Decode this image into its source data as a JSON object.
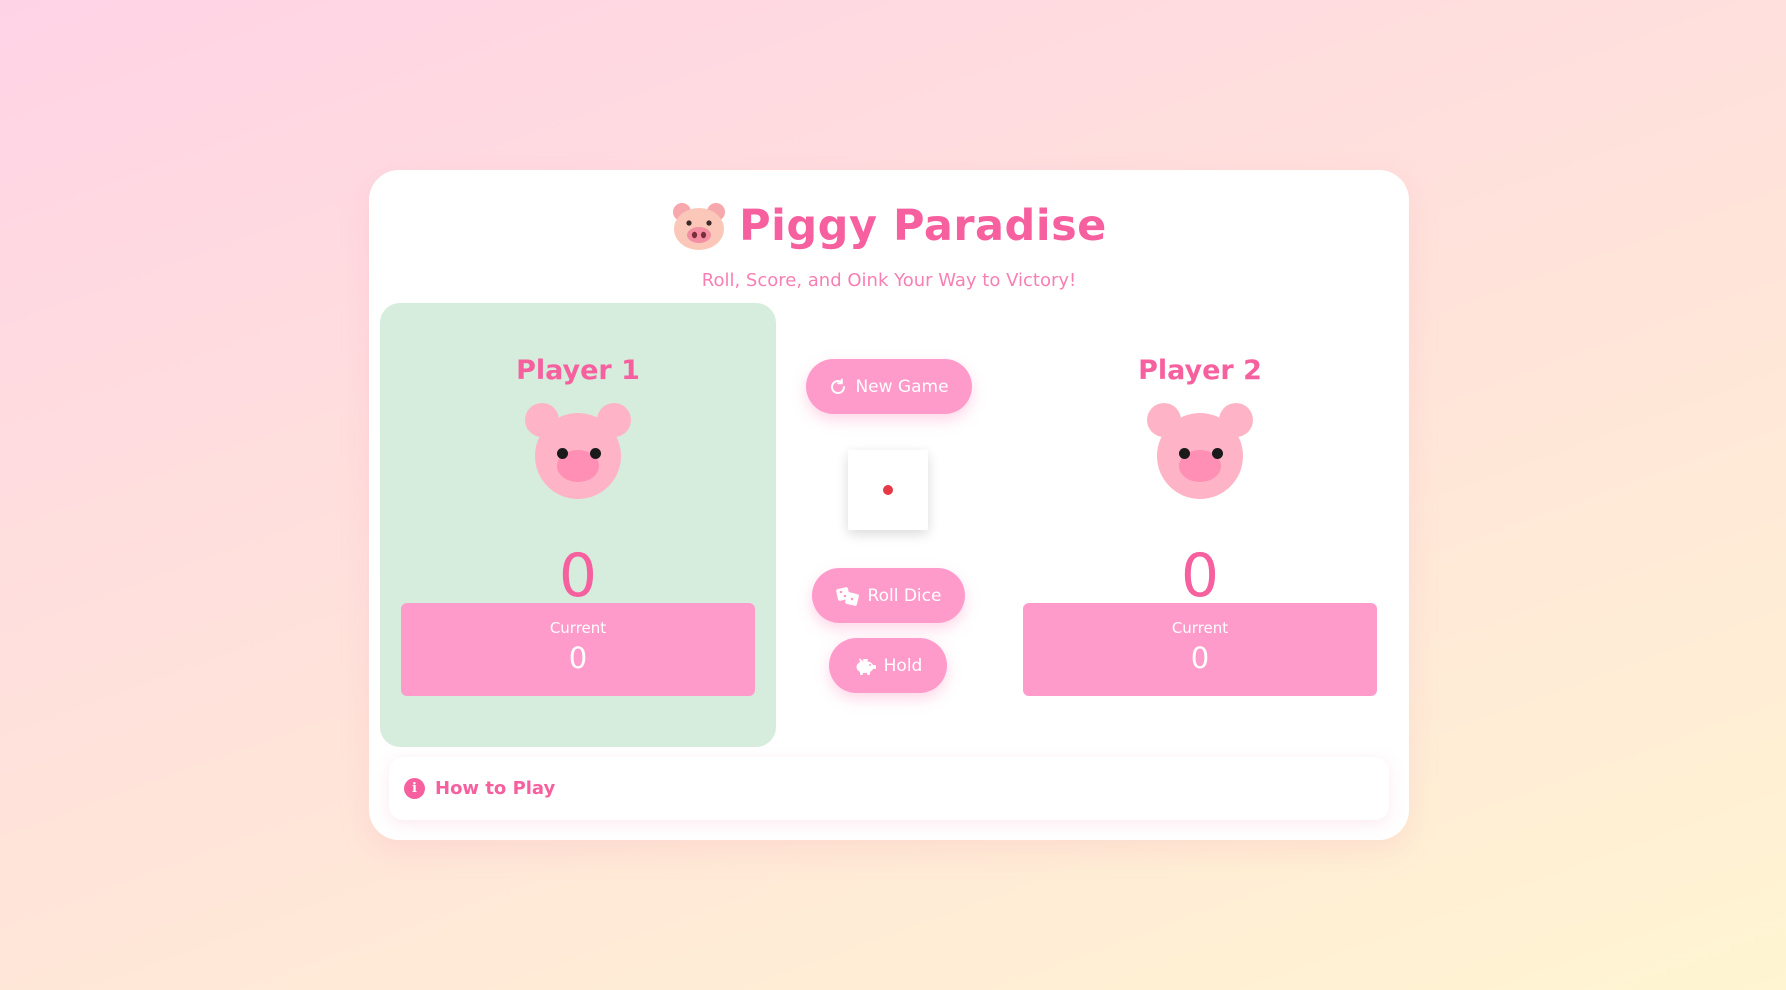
{
  "app": {
    "title": "Piggy Paradise",
    "subtitle": "Roll, Score, and Oink Your Way to Victory!",
    "title_icon": "pig-face-icon"
  },
  "players": [
    {
      "name": "Player 1",
      "score": "0",
      "current_label": "Current",
      "current_value": "0",
      "active": true,
      "avatar_icon": "pig-avatar-icon"
    },
    {
      "name": "Player 2",
      "score": "0",
      "current_label": "Current",
      "current_value": "0",
      "active": false,
      "avatar_icon": "pig-avatar-icon"
    }
  ],
  "controls": {
    "new_game_label": "New Game",
    "new_game_icon": "refresh-icon",
    "roll_dice_label": "Roll Dice",
    "roll_dice_icon": "dice-icon",
    "hold_label": "Hold",
    "hold_icon": "piggy-bank-icon"
  },
  "dice": {
    "value": 1,
    "pip_color": "#e63946"
  },
  "howto": {
    "label": "How to Play",
    "icon": "info-icon"
  },
  "colors": {
    "accent": "#f7609f",
    "button": "#ff9bcb",
    "active_panel": "#d6ecdc",
    "pig": "#ffb3c6"
  }
}
